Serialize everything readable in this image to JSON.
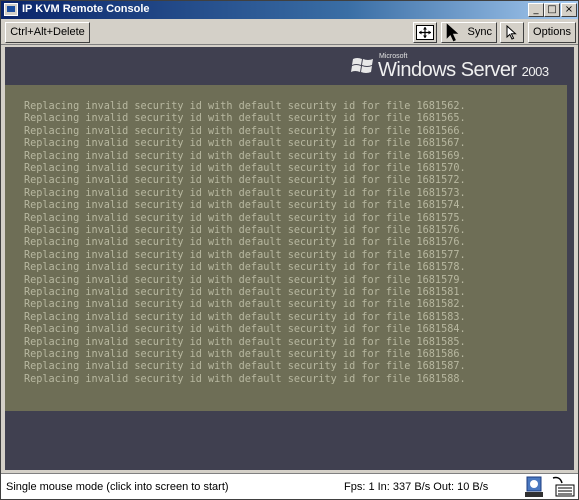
{
  "window": {
    "title": "IP KVM Remote Console",
    "min_glyph": "_",
    "max_glyph": "□",
    "close_glyph": "×"
  },
  "toolbar": {
    "cad_label": "Ctrl+Alt+Delete",
    "fit_icon": "fit-screen-icon",
    "sync_label": "Sync",
    "sync_icon": "mouse-pointer-icon",
    "mouse_icon": "single-cursor-icon",
    "options_label": "Options"
  },
  "logo": {
    "maker": "Microsoft",
    "product": "Windows Server",
    "version": "2003"
  },
  "console": {
    "colors": {
      "background": "#6e6e56",
      "text": "#b8b8a0"
    },
    "lines": [
      "Replacing invalid security id with default security id for file 1681562.",
      "Replacing invalid security id with default security id for file 1681565.",
      "Replacing invalid security id with default security id for file 1681566.",
      "Replacing invalid security id with default security id for file 1681567.",
      "Replacing invalid security id with default security id for file 1681569.",
      "Replacing invalid security id with default security id for file 1681570.",
      "Replacing invalid security id with default security id for file 1681572.",
      "Replacing invalid security id with default security id for file 1681573.",
      "Replacing invalid security id with default security id for file 1681574.",
      "Replacing invalid security id with default security id for file 1681575.",
      "Replacing invalid security id with default security id for file 1681576.",
      "Replacing invalid security id with default security id for file 1681576.",
      "Replacing invalid security id with default security id for file 1681577.",
      "Replacing invalid security id with default security id for file 1681578.",
      "Replacing invalid security id with default security id for file 1681579.",
      "Replacing invalid security id with default security id for file 1681581.",
      "Replacing invalid security id with default security id for file 1681582.",
      "Replacing invalid security id with default security id for file 1681583.",
      "Replacing invalid security id with default security id for file 1681584.",
      "Replacing invalid security id with default security id for file 1681585.",
      "Replacing invalid security id with default security id for file 1681586.",
      "Replacing invalid security id with default security id for file 1681587.",
      "Replacing invalid security id with default security id for file 1681588."
    ]
  },
  "status": {
    "mode": "Single mouse mode (click into screen to start)",
    "stats": "Fps: 1 In: 337 B/s Out: 10 B/s",
    "icons": [
      "network-status-icon",
      "keyboard-icon"
    ]
  }
}
